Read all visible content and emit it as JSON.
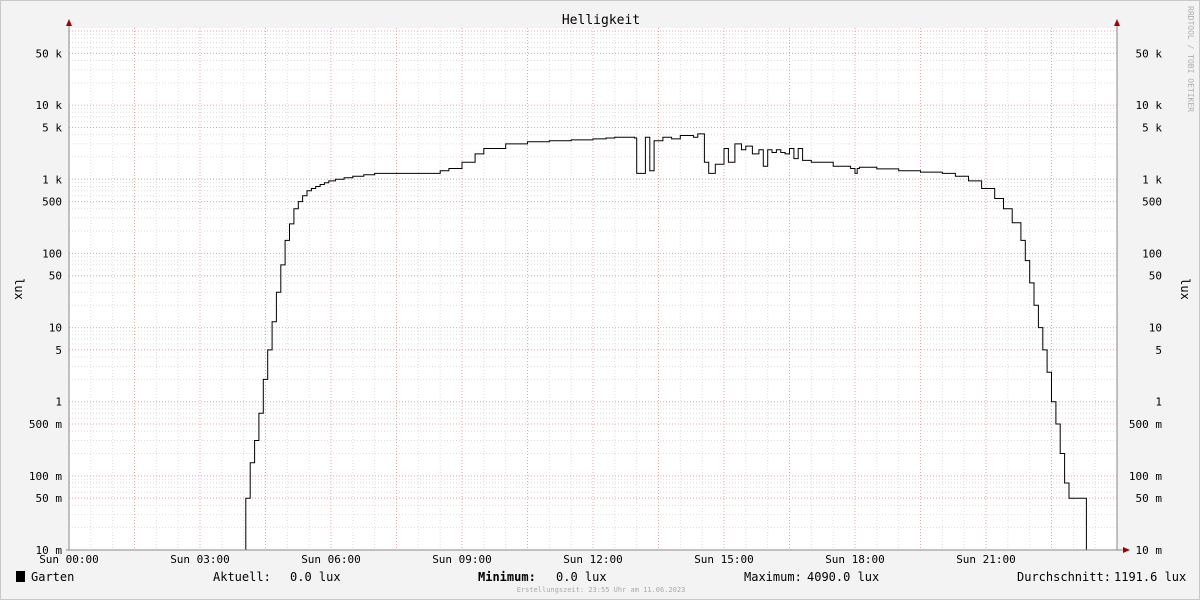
{
  "chart_data": {
    "type": "line",
    "title": "Helligkeit",
    "ylabel": "lux",
    "watermark": "RRDTOOL / TOBI OETIKER",
    "scale": "log",
    "ylim": [
      0.01,
      100000
    ],
    "xlim": [
      0,
      24
    ],
    "xticks": [
      {
        "value": 0,
        "label": "Sun 00:00"
      },
      {
        "value": 3,
        "label": "Sun 03:00"
      },
      {
        "value": 6,
        "label": "Sun 06:00"
      },
      {
        "value": 9,
        "label": "Sun 09:00"
      },
      {
        "value": 12,
        "label": "Sun 12:00"
      },
      {
        "value": 15,
        "label": "Sun 15:00"
      },
      {
        "value": 18,
        "label": "Sun 18:00"
      },
      {
        "value": 21,
        "label": "Sun 21:00"
      }
    ],
    "yticks": [
      {
        "value": 50000,
        "label": "50 k"
      },
      {
        "value": 10000,
        "label": "10 k"
      },
      {
        "value": 5000,
        "label": "5 k"
      },
      {
        "value": 1000,
        "label": "1 k"
      },
      {
        "value": 500,
        "label": "500"
      },
      {
        "value": 100,
        "label": "100"
      },
      {
        "value": 50,
        "label": "50"
      },
      {
        "value": 10,
        "label": "10"
      },
      {
        "value": 5,
        "label": "5"
      },
      {
        "value": 1,
        "label": "1"
      },
      {
        "value": 0.5,
        "label": "500 m"
      },
      {
        "value": 0.1,
        "label": "100 m"
      },
      {
        "value": 0.05,
        "label": "50 m"
      },
      {
        "value": 0.01,
        "label": "10 m"
      }
    ],
    "grid": true,
    "series": [
      {
        "name": "Garten",
        "color": "#000000",
        "x": [
          0,
          4.05,
          4.05,
          4.15,
          4.25,
          4.35,
          4.45,
          4.55,
          4.65,
          4.75,
          4.85,
          4.95,
          5.05,
          5.15,
          5.25,
          5.35,
          5.45,
          5.55,
          5.65,
          5.75,
          5.85,
          5.95,
          6.1,
          6.3,
          6.5,
          6.75,
          7.0,
          7.5,
          8.0,
          8.5,
          8.7,
          9.0,
          9.3,
          9.5,
          10.0,
          10.5,
          11.0,
          11.5,
          12.0,
          12.3,
          12.5,
          12.95,
          13.0,
          13.2,
          13.3,
          13.4,
          13.6,
          13.8,
          14.0,
          14.3,
          14.4,
          14.55,
          14.65,
          14.8,
          15.0,
          15.1,
          15.25,
          15.4,
          15.5,
          15.65,
          15.8,
          15.9,
          16.0,
          16.1,
          16.2,
          16.3,
          16.4,
          16.5,
          16.6,
          16.7,
          16.8,
          17.0,
          17.5,
          17.9,
          18.0,
          18.05,
          18.1,
          18.5,
          19.0,
          19.5,
          20.0,
          20.3,
          20.6,
          20.9,
          21.2,
          21.4,
          21.6,
          21.8,
          21.9,
          22.0,
          22.1,
          22.2,
          22.3,
          22.4,
          22.5,
          22.6,
          22.7,
          22.8,
          22.9,
          22.95,
          23.0,
          23.05,
          23.1,
          23.15,
          23.3,
          23.3,
          24.0
        ],
        "values": [
          0.01,
          0.01,
          0.05,
          0.15,
          0.3,
          0.7,
          2,
          5,
          12,
          30,
          70,
          150,
          250,
          400,
          500,
          600,
          700,
          750,
          800,
          850,
          900,
          950,
          1000,
          1050,
          1100,
          1150,
          1200,
          1200,
          1200,
          1300,
          1400,
          1700,
          2200,
          2600,
          3000,
          3200,
          3300,
          3400,
          3500,
          3600,
          3700,
          3600,
          1200,
          3700,
          1300,
          3300,
          3700,
          3500,
          3900,
          3700,
          4090,
          1700,
          1200,
          1600,
          2600,
          1700,
          3000,
          2500,
          2800,
          2200,
          2500,
          1500,
          2500,
          2300,
          2500,
          2300,
          2200,
          2600,
          1900,
          2600,
          1800,
          1700,
          1500,
          1400,
          1200,
          1400,
          1450,
          1380,
          1300,
          1250,
          1200,
          1100,
          950,
          750,
          550,
          400,
          260,
          150,
          80,
          40,
          20,
          10,
          5,
          2.5,
          1,
          0.5,
          0.2,
          0.08,
          0.05,
          0.05,
          0.05,
          0.05,
          0.05,
          0.05,
          0.05,
          0.01,
          0.01
        ]
      }
    ]
  },
  "legend": {
    "series_name": "Garten",
    "aktuell_label": "Aktuell:",
    "aktuell_value": "0.0 lux",
    "minimum_label": "Minimum:",
    "minimum_value": "0.0 lux",
    "maximum_label": "Maximum:",
    "maximum_value": "4090.0 lux",
    "avg_label": "Durchschnitt:",
    "avg_value": "1191.6 lux"
  },
  "footer": "Erstellungszeit: 23:55 Uhr am 11.06.2023"
}
